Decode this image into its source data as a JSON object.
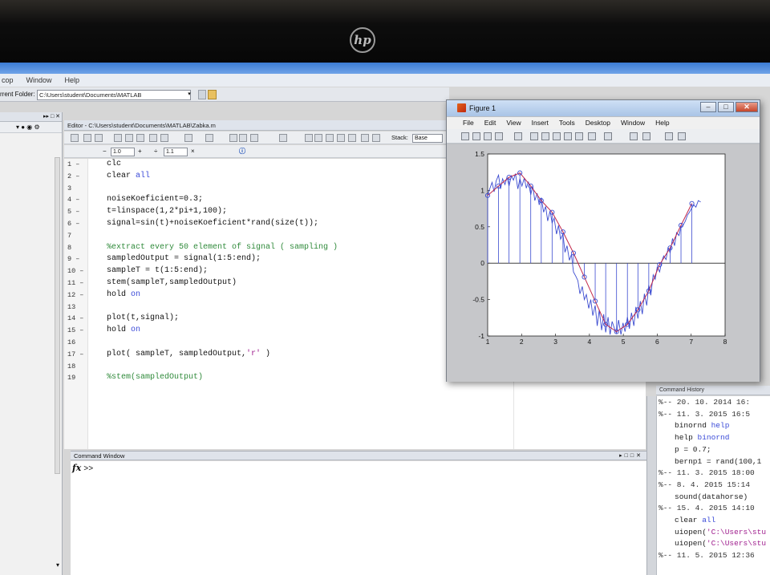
{
  "menubar": [
    "cop",
    "Window",
    "Help"
  ],
  "folder": {
    "label": "rrent Folder:",
    "path": "C:\\Users\\student\\Documents\\MATLAB"
  },
  "editor": {
    "title": "Editor - C:\\Users\\student\\Documents\\MATLAB\\Zabka.m",
    "stack_label": "Stack:",
    "stack_value": "Base",
    "cell_value_1": "1.0",
    "cell_value_2": "1.1",
    "lines": [
      {
        "n": "1 –",
        "parts": [
          {
            "t": "clc",
            "c": ""
          }
        ]
      },
      {
        "n": "2 –",
        "parts": [
          {
            "t": "clear ",
            "c": ""
          },
          {
            "t": "all",
            "c": "kw"
          }
        ]
      },
      {
        "n": "3",
        "parts": []
      },
      {
        "n": "4 –",
        "parts": [
          {
            "t": "noiseKoeficient=0.3;",
            "c": ""
          }
        ]
      },
      {
        "n": "5 –",
        "parts": [
          {
            "t": "t=linspace(1,2*pi+1,100);",
            "c": ""
          }
        ]
      },
      {
        "n": "6 –",
        "parts": [
          {
            "t": "signal=sin(t)+noiseKoeficient*rand(size(t));",
            "c": ""
          }
        ]
      },
      {
        "n": "7",
        "parts": []
      },
      {
        "n": "8",
        "parts": [
          {
            "t": "%extract every 50 element of signal ( sampling )",
            "c": "cm"
          }
        ]
      },
      {
        "n": "9 –",
        "parts": [
          {
            "t": "sampledOutput = signal(1:5:end);",
            "c": ""
          }
        ]
      },
      {
        "n": "10 –",
        "parts": [
          {
            "t": "sampleT = t(1:5:end);",
            "c": ""
          }
        ]
      },
      {
        "n": "11 –",
        "parts": [
          {
            "t": "stem(sampleT,sampledOutput)",
            "c": ""
          }
        ]
      },
      {
        "n": "12 –",
        "parts": [
          {
            "t": "hold ",
            "c": ""
          },
          {
            "t": "on",
            "c": "kw"
          }
        ]
      },
      {
        "n": "13",
        "parts": []
      },
      {
        "n": "14 –",
        "parts": [
          {
            "t": "plot(t,signal);",
            "c": ""
          }
        ]
      },
      {
        "n": "15 –",
        "parts": [
          {
            "t": "hold ",
            "c": ""
          },
          {
            "t": "on",
            "c": "kw"
          }
        ]
      },
      {
        "n": "16",
        "parts": []
      },
      {
        "n": "17 –",
        "parts": [
          {
            "t": "plot( sampleT, sampledOutput,",
            "c": ""
          },
          {
            "t": "'r'",
            "c": "st"
          },
          {
            "t": " )",
            "c": ""
          }
        ]
      },
      {
        "n": "18",
        "parts": []
      },
      {
        "n": "19",
        "parts": [
          {
            "t": "%stem(sampledOutput)",
            "c": "cm"
          }
        ]
      }
    ]
  },
  "command_window": {
    "title": "Command Window",
    "prompt": ">>",
    "fx_icon": "fx"
  },
  "history": {
    "title": "Command History",
    "entries": [
      {
        "kind": "session",
        "text": "%-- 20. 10. 2014 16:"
      },
      {
        "kind": "session",
        "text": "%-- 11. 3. 2015 16:5"
      },
      {
        "kind": "cmd",
        "parts": [
          {
            "t": "binornd ",
            "c": ""
          },
          {
            "t": "help",
            "c": "kw"
          }
        ]
      },
      {
        "kind": "cmd",
        "parts": [
          {
            "t": "help ",
            "c": ""
          },
          {
            "t": "binornd",
            "c": "kw"
          }
        ]
      },
      {
        "kind": "cmd",
        "parts": [
          {
            "t": "p = 0.7;",
            "c": ""
          }
        ]
      },
      {
        "kind": "cmd",
        "parts": [
          {
            "t": "bernp1 = rand(100,1",
            "c": ""
          }
        ]
      },
      {
        "kind": "session",
        "text": "%-- 11. 3. 2015 18:00"
      },
      {
        "kind": "session",
        "text": "%-- 8. 4. 2015 15:14"
      },
      {
        "kind": "cmd",
        "parts": [
          {
            "t": "sound(datahorse)",
            "c": ""
          }
        ]
      },
      {
        "kind": "session",
        "text": "%-- 15. 4. 2015 14:10"
      },
      {
        "kind": "cmd",
        "parts": [
          {
            "t": "clear ",
            "c": ""
          },
          {
            "t": "all",
            "c": "kw"
          }
        ]
      },
      {
        "kind": "cmd",
        "parts": [
          {
            "t": "uiopen(",
            "c": ""
          },
          {
            "t": "'C:\\Users\\stu",
            "c": "st"
          }
        ]
      },
      {
        "kind": "cmd",
        "parts": [
          {
            "t": "uiopen(",
            "c": ""
          },
          {
            "t": "'C:\\Users\\stu",
            "c": "st"
          }
        ]
      },
      {
        "kind": "session",
        "text": "%-- 11. 5. 2015 12:36"
      }
    ]
  },
  "figure": {
    "title": "Figure 1",
    "menu": [
      "File",
      "Edit",
      "View",
      "Insert",
      "Tools",
      "Desktop",
      "Window",
      "Help"
    ]
  },
  "chart_data": {
    "type": "line",
    "x_range": [
      1,
      8
    ],
    "y_range": [
      -1,
      1.5
    ],
    "x_ticks": [
      1,
      2,
      3,
      4,
      5,
      6,
      7,
      8
    ],
    "y_ticks": [
      -1,
      -0.5,
      0,
      0.5,
      1,
      1.5
    ],
    "grid": false,
    "series": [
      {
        "kind": "noisy-line",
        "color": "#3b4bd0",
        "x": [
          1.0,
          1.06,
          1.13,
          1.19,
          1.25,
          1.32,
          1.38,
          1.44,
          1.51,
          1.57,
          1.63,
          1.7,
          1.76,
          1.82,
          1.89,
          1.95,
          2.01,
          2.08,
          2.14,
          2.2,
          2.27,
          2.33,
          2.39,
          2.46,
          2.52,
          2.58,
          2.65,
          2.71,
          2.77,
          2.84,
          2.9,
          2.96,
          3.03,
          3.09,
          3.15,
          3.22,
          3.28,
          3.34,
          3.41,
          3.47,
          3.53,
          3.6,
          3.66,
          3.72,
          3.79,
          3.85,
          3.91,
          3.98,
          4.04,
          4.1,
          4.17,
          4.23,
          4.29,
          4.36,
          4.42,
          4.48,
          4.55,
          4.61,
          4.67,
          4.74,
          4.8,
          4.86,
          4.93,
          4.99,
          5.05,
          5.12,
          5.18,
          5.24,
          5.31,
          5.37,
          5.43,
          5.5,
          5.56,
          5.62,
          5.69,
          5.75,
          5.81,
          5.88,
          5.94,
          6.0,
          6.07,
          6.13,
          6.19,
          6.26,
          6.32,
          6.38,
          6.45,
          6.51,
          6.57,
          6.64,
          6.7,
          6.76,
          6.83,
          6.89,
          6.95,
          7.02,
          7.08,
          7.14,
          7.21,
          7.28
        ],
        "y": [
          0.93,
          1.02,
          1.11,
          0.98,
          1.13,
          1.21,
          1.02,
          1.16,
          1.08,
          1.18,
          1.06,
          1.2,
          1.14,
          1.23,
          1.02,
          1.16,
          1.06,
          1.17,
          1.03,
          1.12,
          0.94,
          1.06,
          0.86,
          0.96,
          0.8,
          0.9,
          0.7,
          0.78,
          0.58,
          0.72,
          0.55,
          0.62,
          0.4,
          0.52,
          0.33,
          0.4,
          0.15,
          0.24,
          0.04,
          0.12,
          -0.12,
          -0.18,
          -0.24,
          -0.42,
          -0.32,
          -0.5,
          -0.43,
          -0.62,
          -0.5,
          -0.72,
          -0.58,
          -0.86,
          -0.64,
          -0.92,
          -0.7,
          -0.95,
          -0.74,
          -0.98,
          -0.8,
          -0.9,
          -0.96,
          -0.78,
          -0.98,
          -0.82,
          -0.94,
          -0.74,
          -0.9,
          -0.68,
          -0.86,
          -0.6,
          -0.76,
          -0.52,
          -0.7,
          -0.42,
          -0.58,
          -0.3,
          -0.44,
          -0.16,
          -0.22,
          -0.05,
          -0.12,
          0.02,
          0.1,
          0.05,
          0.22,
          0.14,
          0.34,
          0.24,
          0.42,
          0.38,
          0.5,
          0.52,
          0.58,
          0.66,
          0.7,
          0.76,
          0.8,
          0.77,
          0.86,
          0.84
        ]
      },
      {
        "kind": "stem-and-red-line",
        "color": "#c2284a",
        "x": [
          1.0,
          1.32,
          1.63,
          1.95,
          2.27,
          2.58,
          2.9,
          3.22,
          3.53,
          3.85,
          4.17,
          4.48,
          4.8,
          5.12,
          5.43,
          5.75,
          6.07,
          6.38,
          6.7,
          7.02
        ],
        "y": [
          0.93,
          1.06,
          1.18,
          1.24,
          1.06,
          0.86,
          0.7,
          0.43,
          0.14,
          -0.19,
          -0.52,
          -0.84,
          -0.94,
          -0.84,
          -0.64,
          -0.38,
          -0.02,
          0.21,
          0.52,
          0.82
        ]
      }
    ]
  }
}
